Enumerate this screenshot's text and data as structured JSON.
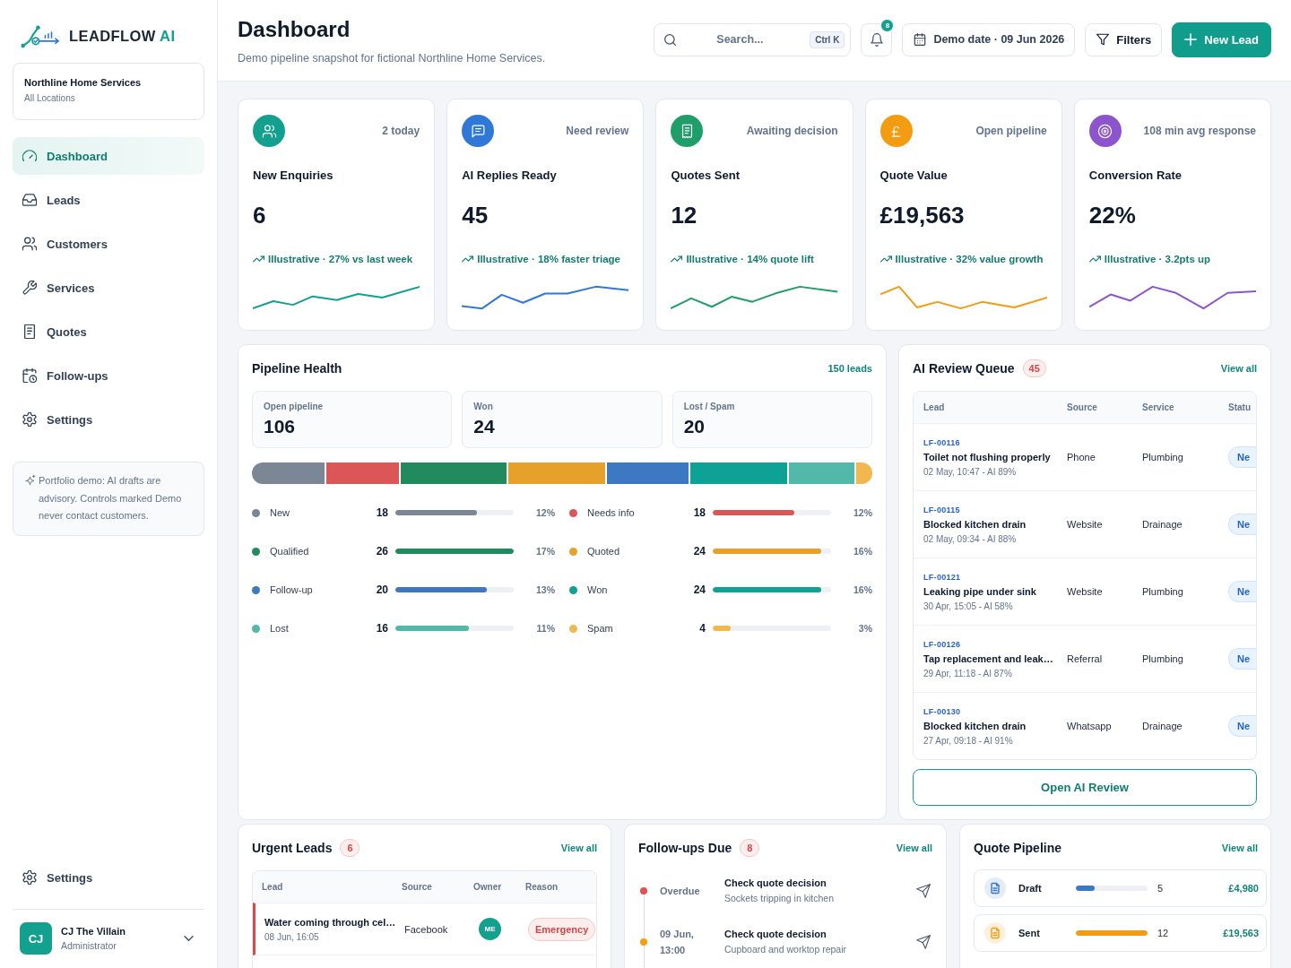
{
  "sidebar": {
    "brand": {
      "name": "LEADFLOW",
      "accent": "AI"
    },
    "org": {
      "name": "Northline Home Services",
      "scope": "All Locations"
    },
    "nav": [
      {
        "label": "Dashboard",
        "selected": true
      },
      {
        "label": "Leads",
        "selected": false
      },
      {
        "label": "Customers",
        "selected": false
      },
      {
        "label": "Services",
        "selected": false
      },
      {
        "label": "Quotes",
        "selected": false
      },
      {
        "label": "Follow-ups",
        "selected": false
      },
      {
        "label": "Settings",
        "selected": false
      }
    ],
    "note": "Portfolio demo: AI drafts are advisory. Controls marked Demo never contact customers.",
    "footer_nav": [
      {
        "label": "Settings",
        "selected": false
      }
    ],
    "user": {
      "initials": "CJ",
      "name": "CJ The Villain",
      "role": "Administrator"
    }
  },
  "header": {
    "title": "Dashboard",
    "subtitle": "Demo pipeline snapshot for fictional Northline Home Services.",
    "search": {
      "placeholder": "Search...",
      "shortcut": "Ctrl K"
    },
    "notifications": {
      "count": "8"
    },
    "date_button": "Demo date · 09 Jun 2026",
    "filters_button": "Filters",
    "new_lead_button": "New Lead"
  },
  "kpis": [
    {
      "color": "#14a08f",
      "note": "2 today",
      "label": "New Enquiries",
      "value": "6",
      "trend": "Illustrative · 27% vs last week"
    },
    {
      "color": "#2f78d8",
      "note": "Need review",
      "label": "AI Replies Ready",
      "value": "45",
      "trend": "Illustrative · 18% faster triage"
    },
    {
      "color": "#1f9e6a",
      "note": "Awaiting decision",
      "label": "Quotes Sent",
      "value": "12",
      "trend": "Illustrative · 14% quote lift"
    },
    {
      "color": "#f39c12",
      "note": "Open pipeline",
      "label": "Quote Value",
      "value": "£19,563",
      "trend": "Illustrative · 32% value growth"
    },
    {
      "color": "#8c55cd",
      "note": "108 min avg response",
      "label": "Conversion Rate",
      "value": "22%",
      "trend": "Illustrative · 3.2pts up"
    }
  ],
  "pipeline_health": {
    "title": "Pipeline Health",
    "total": "150 leads",
    "stats": [
      {
        "label": "Open pipeline",
        "value": "106"
      },
      {
        "label": "Won",
        "value": "24"
      },
      {
        "label": "Lost / Spam",
        "value": "20"
      }
    ],
    "stages": [
      {
        "name": "New",
        "count": "18",
        "share": "12%",
        "level": 0.69,
        "color": "#7b8794"
      },
      {
        "name": "Needs info",
        "count": "18",
        "share": "12%",
        "level": 0.69,
        "color": "#db5757"
      },
      {
        "name": "Qualified",
        "count": "26",
        "share": "17%",
        "level": 1,
        "color": "#23895f"
      },
      {
        "name": "Quoted",
        "count": "24",
        "share": "16%",
        "level": 0.92,
        "color": "#e5a12a"
      },
      {
        "name": "Follow-up",
        "count": "20",
        "share": "13%",
        "level": 0.77,
        "color": "#3d78c2"
      },
      {
        "name": "Won",
        "count": "24",
        "share": "16%",
        "level": 0.92,
        "color": "#0da293"
      },
      {
        "name": "Lost",
        "count": "16",
        "share": "11%",
        "level": 0.62,
        "color": "#52b8a8"
      },
      {
        "name": "Spam",
        "count": "4",
        "share": "3%",
        "level": 0.15,
        "color": "#f0b84e"
      }
    ]
  },
  "ai_review_queue": {
    "title": "AI Review Queue",
    "count": "45",
    "view_all": "View all",
    "columns": [
      "Lead",
      "Source",
      "Service",
      "Statu"
    ],
    "rows": [
      {
        "id": "LF-00116",
        "title": "Toilet not flushing properly",
        "meta": "02 May, 10:47 - AI 89%",
        "source": "Phone",
        "service": "Plumbing",
        "status": "Ne"
      },
      {
        "id": "LF-00115",
        "title": "Blocked kitchen drain",
        "meta": "02 May, 09:34 - AI 88%",
        "source": "Website",
        "service": "Drainage",
        "status": "Ne"
      },
      {
        "id": "LF-00121",
        "title": "Leaking pipe under sink",
        "meta": "30 Apr, 15:05 - AI 58%",
        "source": "Website",
        "service": "Plumbing",
        "status": "Ne"
      },
      {
        "id": "LF-00126",
        "title": "Tap replacement and leak…",
        "meta": "29 Apr, 11:18 - AI 87%",
        "source": "Referral",
        "service": "Plumbing",
        "status": "Ne"
      },
      {
        "id": "LF-00130",
        "title": "Blocked kitchen drain",
        "meta": "27 Apr, 09:18 - AI 91%",
        "source": "Whatsapp",
        "service": "Drainage",
        "status": "Ne"
      }
    ],
    "button": "Open AI Review"
  },
  "urgent_leads": {
    "title": "Urgent Leads",
    "count": "6",
    "view_all": "View all",
    "columns": [
      "Lead",
      "Source",
      "Owner",
      "Reason"
    ],
    "rows": [
      {
        "title": "Water coming through cel…",
        "time": "08 Jun, 16:05",
        "source": "Facebook",
        "owner": "ME",
        "reason": "Emergency"
      }
    ]
  },
  "follow_ups": {
    "title": "Follow-ups Due",
    "count": "8",
    "view_all": "View all",
    "items": [
      {
        "when": "Overdue",
        "color": "#e05252",
        "title": "Check quote decision",
        "detail": "Sockets tripping in kitchen"
      },
      {
        "when": "09 Jun, 13:00",
        "color": "#f59e0b",
        "title": "Check quote decision",
        "detail": "Cupboard and worktop repair"
      }
    ]
  },
  "quote_pipeline": {
    "title": "Quote Pipeline",
    "view_all": "View all",
    "rows": [
      {
        "stage": "Draft",
        "level": 0.26,
        "count": "5",
        "value": "£4,980",
        "color": "#3b78c9"
      },
      {
        "stage": "Sent",
        "level": 1,
        "count": "12",
        "value": "£19,563",
        "color": "#f39c12"
      }
    ]
  }
}
